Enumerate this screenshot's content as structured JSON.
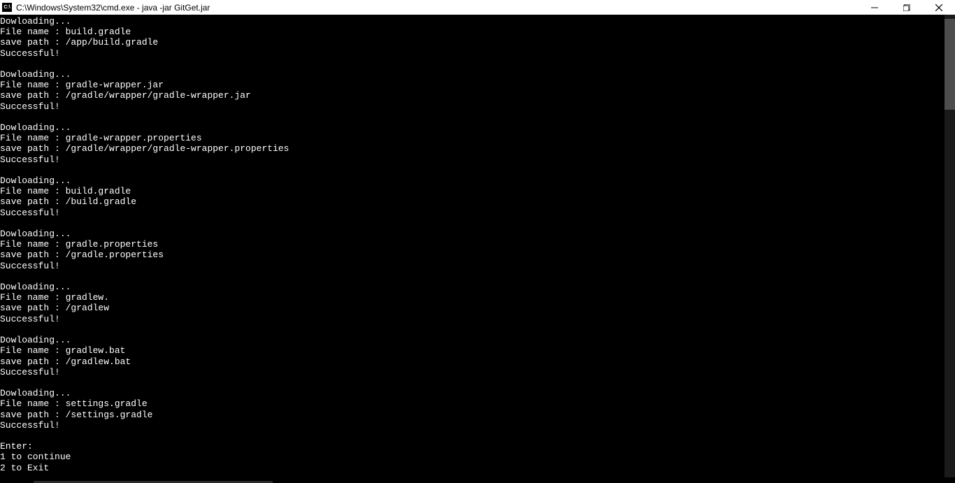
{
  "titlebar": {
    "icon_label": "cmd",
    "title": "C:\\Windows\\System32\\cmd.exe - java  -jar GitGet.jar"
  },
  "downloads": [
    {
      "status": "Dowloading...",
      "filename_label": "File name : ",
      "filename": "build.gradle",
      "savepath_label": "save path : ",
      "savepath": "/app/build.gradle",
      "result": "Successful!"
    },
    {
      "status": "Dowloading...",
      "filename_label": "File name : ",
      "filename": "gradle-wrapper.jar",
      "savepath_label": "save path : ",
      "savepath": "/gradle/wrapper/gradle-wrapper.jar",
      "result": "Successful!"
    },
    {
      "status": "Dowloading...",
      "filename_label": "File name : ",
      "filename": "gradle-wrapper.properties",
      "savepath_label": "save path : ",
      "savepath": "/gradle/wrapper/gradle-wrapper.properties",
      "result": "Successful!"
    },
    {
      "status": "Dowloading...",
      "filename_label": "File name : ",
      "filename": "build.gradle",
      "savepath_label": "save path : ",
      "savepath": "/build.gradle",
      "result": "Successful!"
    },
    {
      "status": "Dowloading...",
      "filename_label": "File name : ",
      "filename": "gradle.properties",
      "savepath_label": "save path : ",
      "savepath": "/gradle.properties",
      "result": "Successful!"
    },
    {
      "status": "Dowloading...",
      "filename_label": "File name : ",
      "filename": "gradlew.",
      "savepath_label": "save path : ",
      "savepath": "/gradlew",
      "result": "Successful!"
    },
    {
      "status": "Dowloading...",
      "filename_label": "File name : ",
      "filename": "gradlew.bat",
      "savepath_label": "save path : ",
      "savepath": "/gradlew.bat",
      "result": "Successful!"
    },
    {
      "status": "Dowloading...",
      "filename_label": "File name : ",
      "filename": "settings.gradle",
      "savepath_label": "save path : ",
      "savepath": "/settings.gradle",
      "result": "Successful!"
    }
  ],
  "prompt": {
    "enter": "Enter:",
    "opt1": "1 to continue",
    "opt2": "2 to Exit"
  }
}
